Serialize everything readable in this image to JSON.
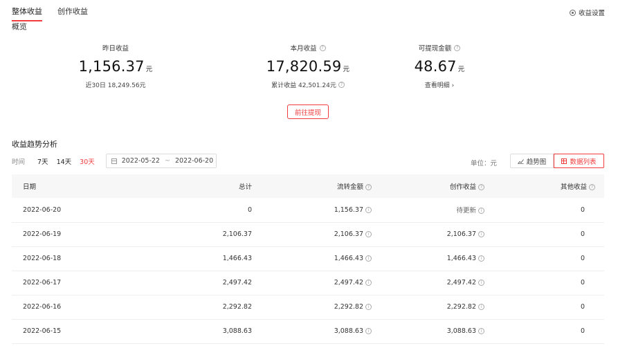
{
  "tabs": [
    {
      "label": "整体收益",
      "active": true
    },
    {
      "label": "创作收益",
      "active": false
    }
  ],
  "settings_label": "收益设置",
  "overview_label": "概览",
  "stats": {
    "yesterday": {
      "label": "昨日收益",
      "value": "1,156.37",
      "unit": "元",
      "sub": "近30日 18,249.56元"
    },
    "month": {
      "label": "本月收益",
      "value": "17,820.59",
      "unit": "元",
      "sub": "累计收益 42,501.24元"
    },
    "withdrawable": {
      "label": "可提现金额",
      "value": "48.67",
      "unit": "元",
      "sub": "查看明细 ›"
    }
  },
  "withdraw_button": "前往提现",
  "trend": {
    "title": "收益趋势分析",
    "time_label": "时间",
    "ranges": [
      {
        "label": "7天",
        "active": false
      },
      {
        "label": "14天",
        "active": false
      },
      {
        "label": "30天",
        "active": true
      }
    ],
    "date_start": "2022-05-22",
    "date_sep": "~",
    "date_end": "2022-06-20",
    "unit_label": "单位：元",
    "view_trend": "趋势图",
    "view_list": "数据列表"
  },
  "table": {
    "headers": {
      "date": "日期",
      "total": "总计",
      "flow": "流转金额",
      "create": "创作收益",
      "other": "其他收益"
    },
    "rows": [
      {
        "date": "2022-06-20",
        "total": "0",
        "flow": "1,156.37",
        "create": "待更新",
        "other": "0"
      },
      {
        "date": "2022-06-19",
        "total": "2,106.37",
        "flow": "2,106.37",
        "create": "2,106.37",
        "other": "0"
      },
      {
        "date": "2022-06-18",
        "total": "1,466.43",
        "flow": "1,466.43",
        "create": "1,466.43",
        "other": "0"
      },
      {
        "date": "2022-06-17",
        "total": "2,497.42",
        "flow": "2,497.42",
        "create": "2,497.42",
        "other": "0"
      },
      {
        "date": "2022-06-16",
        "total": "2,292.82",
        "flow": "2,292.82",
        "create": "2,292.82",
        "other": "0"
      },
      {
        "date": "2022-06-15",
        "total": "3,088.63",
        "flow": "3,088.63",
        "create": "3,088.63",
        "other": "0"
      }
    ]
  },
  "colors": {
    "accent": "#f03c3c",
    "header_bg": "#f7f7f7"
  }
}
